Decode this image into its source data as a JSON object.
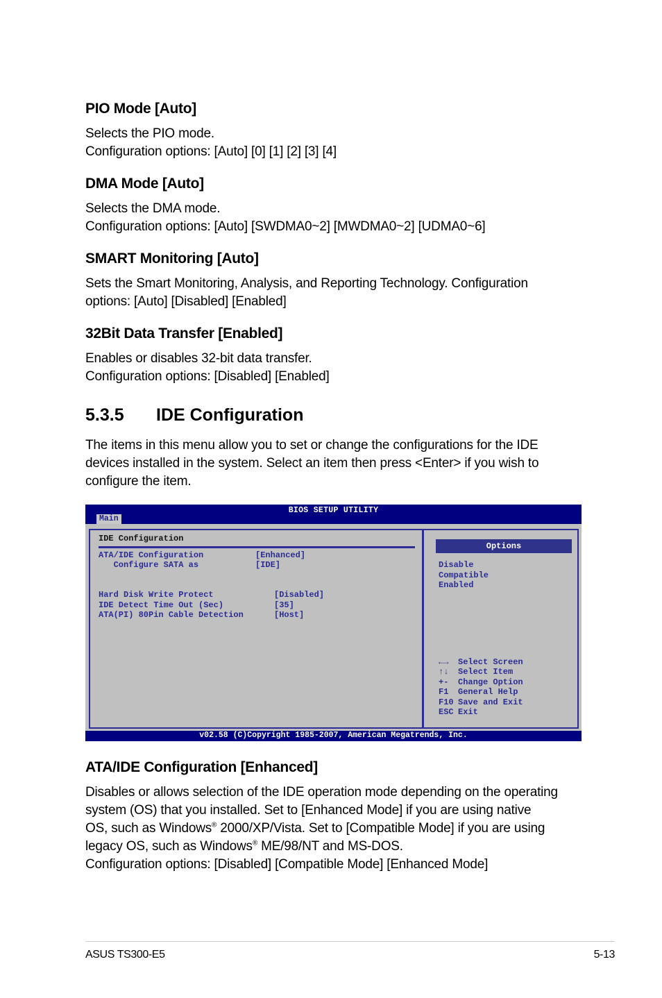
{
  "sections": [
    {
      "heading": "PIO Mode [Auto]",
      "lines": [
        "Selects the PIO mode.",
        "Configuration options: [Auto] [0] [1] [2] [3] [4]"
      ]
    },
    {
      "heading": "DMA Mode [Auto]",
      "lines": [
        "Selects the DMA mode.",
        "Configuration options: [Auto] [SWDMA0~2] [MWDMA0~2] [UDMA0~6]"
      ]
    },
    {
      "heading": "SMART Monitoring [Auto]",
      "lines": [
        "Sets the Smart Monitoring, Analysis, and Reporting Technology. Configuration",
        "options: [Auto] [Disabled] [Enabled]"
      ]
    },
    {
      "heading": "32Bit Data Transfer [Enabled]",
      "lines": [
        "Enables or disables 32-bit data transfer.",
        "Configuration options: [Disabled] [Enabled]"
      ]
    }
  ],
  "chapter": {
    "number": "5.3.5",
    "title": "IDE Configuration",
    "intro": [
      "The items in this menu allow you to set or change the configurations for the IDE",
      "devices installed in the system. Select an item then press <Enter> if you wish to",
      "configure the item."
    ]
  },
  "bios": {
    "title": "BIOS SETUP UTILITY",
    "tab": "Main",
    "section_title": "IDE Configuration",
    "items": [
      {
        "label": "ATA/IDE Configuration",
        "value": "[Enhanced]"
      },
      {
        "label": "   Configure SATA as",
        "value": "[IDE]"
      },
      {
        "label": "Hard Disk Write Protect",
        "value": "[Disabled]"
      },
      {
        "label": "IDE Detect Time Out (Sec)",
        "value": "[35]"
      },
      {
        "label": "ATA(PI) 80Pin Cable Detection",
        "value": "[Host]"
      }
    ],
    "options_title": "Options",
    "options": [
      "Disable",
      "Compatible",
      "Enabled"
    ],
    "keys": [
      {
        "key": "←→",
        "action": "Select Screen"
      },
      {
        "key": "↑↓",
        "action": "Select Item"
      },
      {
        "key": "+-",
        "action": "Change Option"
      },
      {
        "key": "F1",
        "action": "General Help"
      },
      {
        "key": "F10",
        "action": "Save and Exit"
      },
      {
        "key": "ESC",
        "action": "Exit"
      }
    ],
    "footer": "v02.58 (C)Copyright 1985-2007, American Megatrends, Inc."
  },
  "ata_section": {
    "heading": "ATA/IDE Configuration [Enhanced]",
    "line1": "Disables or allows selection of the IDE operation mode depending on the operating",
    "line2": "system (OS) that you installed. Set to [Enhanced Mode] if you are using native",
    "line3a": "OS, such as Windows",
    "line3b": " 2000/XP/Vista. Set to [Compatible Mode] if you are using",
    "line4a": "legacy OS, such as Windows",
    "line4b": " ME/98/NT and MS-DOS.",
    "line5": "Configuration options: [Disabled] [Compatible Mode] [Enhanced Mode]",
    "registered": "®"
  },
  "footer": {
    "left": "ASUS TS300-E5",
    "right": "5-13"
  }
}
